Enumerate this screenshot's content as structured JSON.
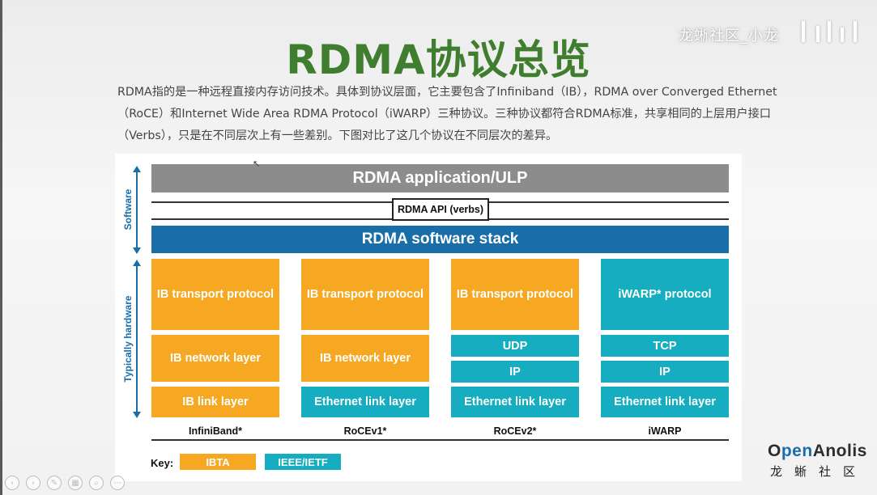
{
  "watermark": {
    "text": "龙蜥社区_小龙"
  },
  "slide": {
    "title": "RDMA协议总览",
    "intro": "RDMA指的是一种远程直接内存访问技术。具体到协议层面，它主要包含了Infiniband（IB），RDMA over Converged Ethernet（RoCE）和Internet Wide Area RDMA Protocol（iWARP）三种协议。三种协议都符合RDMA标准，共享相同的上层用户接口（Verbs），只是在不同层次上有一些差别。下图对比了这几个协议在不同层次的差异。"
  },
  "diagram": {
    "app_bar": "RDMA application/ULP",
    "api_box": "RDMA API (verbs)",
    "stack_bar": "RDMA software stack",
    "side_software": "Software",
    "side_hardware": "Typically hardware",
    "columns": [
      {
        "name": "InfiniBand*",
        "transport": "IB transport protocol",
        "network": "IB network layer",
        "link": "IB link layer"
      },
      {
        "name": "RoCEv1*",
        "transport": "IB transport protocol",
        "network": "IB network layer",
        "link": "Ethernet link layer"
      },
      {
        "name": "RoCEv2*",
        "transport": "IB transport protocol",
        "udp": "UDP",
        "ip": "IP",
        "link": "Ethernet link layer"
      },
      {
        "name": "iWARP",
        "transport": "iWARP* protocol",
        "tcp": "TCP",
        "ip": "IP",
        "link": "Ethernet link layer"
      }
    ],
    "key": {
      "label": "Key:",
      "ibta": "IBTA",
      "ieee": "IEEE/IETF"
    },
    "colors": {
      "orange": "#f7a823",
      "teal": "#15adbf",
      "blue": "#1a6ea8",
      "gray": "#8c8c8c"
    }
  },
  "logo": {
    "prefix": "O",
    "accent": "pen",
    "suffix": "Anolis",
    "sub": "龙蜥社区"
  },
  "toolbar": {
    "icons": [
      "prev-icon",
      "next-icon",
      "pen-icon",
      "slides-icon",
      "zoom-icon",
      "more-icon"
    ],
    "glyphs": [
      "‹",
      "›",
      "✎",
      "▦",
      "⌕",
      "⋯"
    ]
  }
}
